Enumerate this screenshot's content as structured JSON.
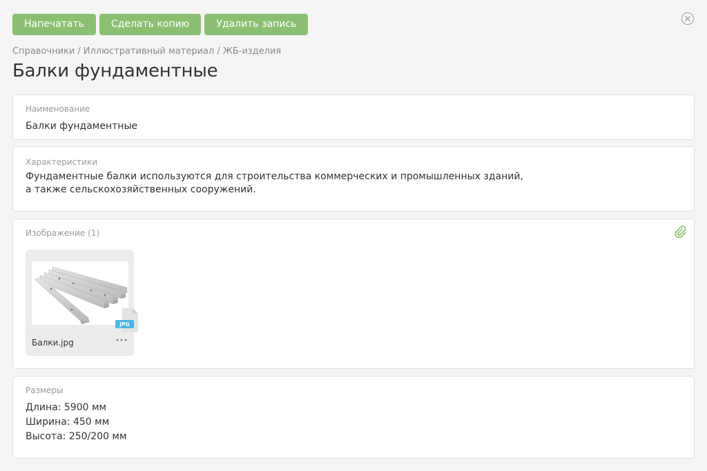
{
  "toolbar": {
    "print_label": "Напечатать",
    "copy_label": "Сделать копию",
    "delete_label": "Удалить запись"
  },
  "breadcrumb": [
    "Справочники",
    "Иллюстративный материал",
    "ЖБ-изделия"
  ],
  "page_title": "Балки фундаментные",
  "fields": {
    "name": {
      "label": "Наименование",
      "value": "Балки фундаментные"
    },
    "characteristics": {
      "label": "Характеристики",
      "lines": [
        "Фундаментные балки используются для строительства коммерческих и промышленных зданий,",
        "а также сельскохозяйственных сооружений."
      ]
    },
    "image": {
      "label": "Изображение (1)",
      "files": [
        {
          "name": "Балки.jpg",
          "type": "JPG"
        }
      ]
    },
    "dimensions": {
      "label": "Размеры",
      "lines": [
        "Длина: 5900 мм",
        "Ширина: 450 мм",
        "Высота: 250/200 мм"
      ]
    }
  },
  "icons": [
    "close-icon",
    "paperclip-icon",
    "jpg-file-icon",
    "more-icon"
  ],
  "colors": {
    "accent": "#8bc072",
    "badge": "#4db6e4",
    "background": "#f5f5f5"
  }
}
